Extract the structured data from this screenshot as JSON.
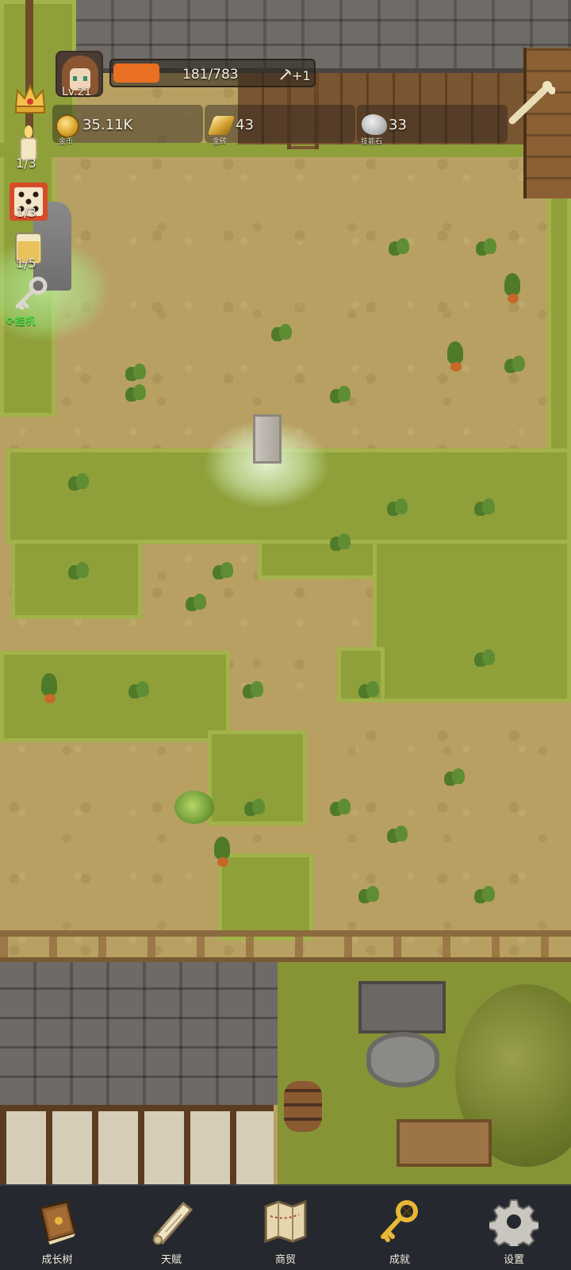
{
  "hud": {
    "level": "Lv.21",
    "xp_text": "181/783",
    "xp_fraction": 0.231,
    "xp_bonus": "+1"
  },
  "resources": [
    {
      "icon": "gold-coin-icon",
      "value": "35.11K",
      "label": "金币"
    },
    {
      "icon": "gold-bar-icon",
      "value": "43",
      "label": "金砖"
    },
    {
      "icon": "skill-stone-icon",
      "value": "33",
      "label": "技能石"
    }
  ],
  "side_panel": {
    "candle_count": "1/3",
    "dice_count": "1/3",
    "drink_count": "1/5",
    "afk_label": "挂机"
  },
  "nav": [
    {
      "icon": "book-icon",
      "label": "成长树"
    },
    {
      "icon": "scroll-icon",
      "label": "天赋"
    },
    {
      "icon": "map-icon",
      "label": "商贸"
    },
    {
      "icon": "key-icon",
      "label": "成就"
    },
    {
      "icon": "gear-icon",
      "label": "设置"
    }
  ],
  "colors": {
    "xp_fill": "#e96f22",
    "grass": "#8fa03a",
    "dirt": "#b8a063",
    "nav_bg": "#25282e",
    "afk_text": "#3cf240"
  }
}
